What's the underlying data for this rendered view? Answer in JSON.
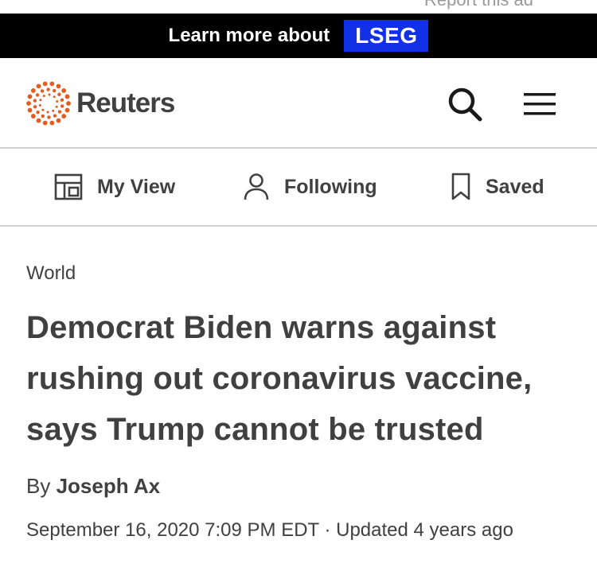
{
  "ad": {
    "report_label": "Report this ad",
    "text": "Learn more about",
    "brand": "LSEG"
  },
  "header": {
    "logo_text": "Reuters",
    "logo_color": "#e35b1e",
    "search_icon": "search-icon",
    "menu_icon": "hamburger-menu-icon"
  },
  "user_nav": {
    "items": [
      {
        "label": "My View",
        "icon": "layout-icon"
      },
      {
        "label": "Following",
        "icon": "person-icon"
      },
      {
        "label": "Saved",
        "icon": "bookmark-icon"
      }
    ]
  },
  "article": {
    "section": "World",
    "headline": "Democrat Biden warns against rushing out coronavirus vaccine, says Trump cannot be trusted",
    "byline_prefix": "By",
    "author": "Joseph Ax",
    "date": "September 16, 2020 7:09 PM EDT",
    "separator": "·",
    "updated": "Updated 4 years ago"
  },
  "colors": {
    "ad_background": "#000000",
    "brand_blue": "#1230e6",
    "text": "#404040",
    "divider": "#d0d0d0"
  }
}
